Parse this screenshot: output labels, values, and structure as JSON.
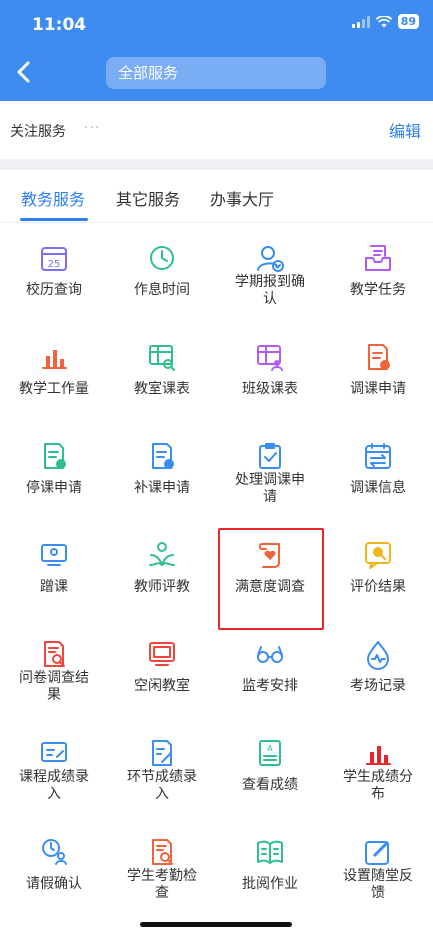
{
  "status": {
    "time": "11:04",
    "battery": "89"
  },
  "header": {
    "back_icon": "chevron-left-icon",
    "title": "全部服务"
  },
  "favorites": {
    "label": "关注服务",
    "dots": "···",
    "edit": "编辑"
  },
  "tabs": [
    {
      "label": "教务服务",
      "active": true
    },
    {
      "label": "其它服务",
      "active": false
    },
    {
      "label": "办事大厅",
      "active": false
    }
  ],
  "services": [
    {
      "label": "校历查询",
      "icon": "calendar-icon",
      "color": "#7b6ff0"
    },
    {
      "label": "作息时间",
      "icon": "clock-icon",
      "color": "#2fbf8f"
    },
    {
      "label": "学期报到确认",
      "icon": "user-check-icon",
      "color": "#3a8ef0"
    },
    {
      "label": "教学任务",
      "icon": "inbox-icon",
      "color": "#b45cf0"
    },
    {
      "label": "教学工作量",
      "icon": "bar-chart-icon",
      "color": "#f0643c"
    },
    {
      "label": "教室课表",
      "icon": "table-search-icon",
      "color": "#2fbf8f"
    },
    {
      "label": "班级课表",
      "icon": "table-user-icon",
      "color": "#b45cf0"
    },
    {
      "label": "调课申请",
      "icon": "document-badge-icon",
      "color": "#f0643c"
    },
    {
      "label": "停课申请",
      "icon": "document-stop-icon",
      "color": "#2fbf8f"
    },
    {
      "label": "补课申请",
      "icon": "document-add-icon",
      "color": "#3a8ef0"
    },
    {
      "label": "处理调课申请",
      "icon": "clipboard-check-icon",
      "color": "#3a8ef0"
    },
    {
      "label": "调课信息",
      "icon": "calendar-swap-icon",
      "color": "#3a8ef0"
    },
    {
      "label": "蹭课",
      "icon": "screen-user-icon",
      "color": "#3a8ef0"
    },
    {
      "label": "教师评教",
      "icon": "lotus-user-icon",
      "color": "#2fbf8f"
    },
    {
      "label": "满意度调查",
      "icon": "heart-scroll-icon",
      "color": "#f0643c"
    },
    {
      "label": "评价结果",
      "icon": "speech-search-icon",
      "color": "#f0b41c"
    },
    {
      "label": "问卷调查结果",
      "icon": "document-search-icon",
      "color": "#f0463c"
    },
    {
      "label": "空闲教室",
      "icon": "monitor-icon",
      "color": "#f0463c"
    },
    {
      "label": "监考安排",
      "icon": "glasses-icon",
      "color": "#3a8ef0"
    },
    {
      "label": "考场记录",
      "icon": "drop-pulse-icon",
      "color": "#3a8ef0"
    },
    {
      "label": "课程成绩录入",
      "icon": "card-edit-icon",
      "color": "#3a8ef0"
    },
    {
      "label": "环节成绩录入",
      "icon": "document-edit-icon",
      "color": "#3a8ef0"
    },
    {
      "label": "查看成绩",
      "icon": "grade-sheet-icon",
      "color": "#2fbf8f"
    },
    {
      "label": "学生成绩分布",
      "icon": "bar-chart-icon",
      "color": "#e5262a"
    },
    {
      "label": "请假确认",
      "icon": "clock-user-icon",
      "color": "#3a8ef0"
    },
    {
      "label": "学生考勤检查",
      "icon": "document-search-icon",
      "color": "#f0643c"
    },
    {
      "label": "批阅作业",
      "icon": "book-icon",
      "color": "#2fbf8f"
    },
    {
      "label": "设置随堂反馈",
      "icon": "pencil-box-icon",
      "color": "#3a8ef0"
    }
  ]
}
